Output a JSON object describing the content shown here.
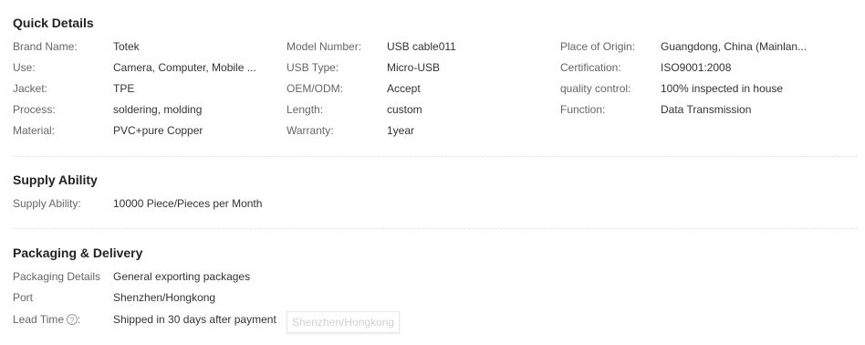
{
  "quick_details": {
    "title": "Quick Details",
    "col1": [
      {
        "label": "Brand Name:",
        "value": "Totek"
      },
      {
        "label": "Use:",
        "value": "Camera, Computer, Mobile ..."
      },
      {
        "label": "Jacket:",
        "value": "TPE"
      },
      {
        "label": "Process:",
        "value": "soldering, molding"
      },
      {
        "label": "Material:",
        "value": "PVC+pure Copper"
      }
    ],
    "col2": [
      {
        "label": "Model Number:",
        "value": "USB cable011"
      },
      {
        "label": "USB Type:",
        "value": "Micro-USB"
      },
      {
        "label": "OEM/ODM:",
        "value": "Accept"
      },
      {
        "label": "Length:",
        "value": "custom"
      },
      {
        "label": "Warranty:",
        "value": "1year"
      }
    ],
    "col3": [
      {
        "label": "Place of Origin:",
        "value": "Guangdong, China (Mainlan..."
      },
      {
        "label": "Certification:",
        "value": "ISO9001:2008"
      },
      {
        "label": "quality control:",
        "value": "100% inspected in house"
      },
      {
        "label": "Function:",
        "value": "Data Transmission"
      }
    ]
  },
  "supply_ability": {
    "title": "Supply Ability",
    "label": "Supply Ability:",
    "value": "10000 Piece/Pieces per Month"
  },
  "packaging": {
    "title": "Packaging & Delivery",
    "packaging_details_label": "Packaging Details",
    "packaging_details_value": "General exporting packages",
    "port_label": "Port",
    "port_value": "Shenzhen/Hongkong",
    "lead_time_label": "Lead Time",
    "lead_time_suffix": ":",
    "lead_time_value": "Shipped in 30 days after payment",
    "help_icon": "question-circle-icon",
    "help_glyph": "?",
    "tooltip_text": "Shenzhen/Hongkong"
  }
}
